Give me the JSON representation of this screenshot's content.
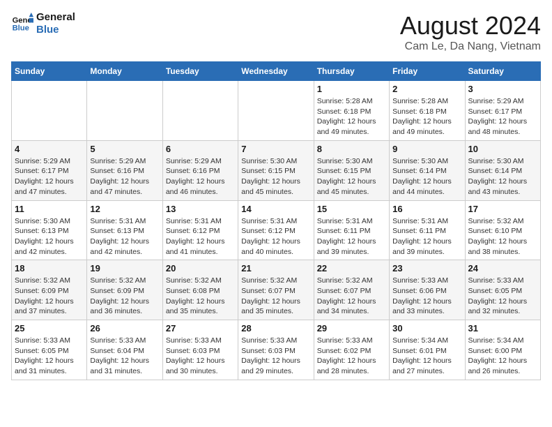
{
  "logo": {
    "name_line1": "General",
    "name_line2": "Blue"
  },
  "header": {
    "title": "August 2024",
    "subtitle": "Cam Le, Da Nang, Vietnam"
  },
  "weekdays": [
    "Sunday",
    "Monday",
    "Tuesday",
    "Wednesday",
    "Thursday",
    "Friday",
    "Saturday"
  ],
  "weeks": [
    [
      {
        "day": "",
        "info": ""
      },
      {
        "day": "",
        "info": ""
      },
      {
        "day": "",
        "info": ""
      },
      {
        "day": "",
        "info": ""
      },
      {
        "day": "1",
        "info": "Sunrise: 5:28 AM\nSunset: 6:18 PM\nDaylight: 12 hours\nand 49 minutes."
      },
      {
        "day": "2",
        "info": "Sunrise: 5:28 AM\nSunset: 6:18 PM\nDaylight: 12 hours\nand 49 minutes."
      },
      {
        "day": "3",
        "info": "Sunrise: 5:29 AM\nSunset: 6:17 PM\nDaylight: 12 hours\nand 48 minutes."
      }
    ],
    [
      {
        "day": "4",
        "info": "Sunrise: 5:29 AM\nSunset: 6:17 PM\nDaylight: 12 hours\nand 47 minutes."
      },
      {
        "day": "5",
        "info": "Sunrise: 5:29 AM\nSunset: 6:16 PM\nDaylight: 12 hours\nand 47 minutes."
      },
      {
        "day": "6",
        "info": "Sunrise: 5:29 AM\nSunset: 6:16 PM\nDaylight: 12 hours\nand 46 minutes."
      },
      {
        "day": "7",
        "info": "Sunrise: 5:30 AM\nSunset: 6:15 PM\nDaylight: 12 hours\nand 45 minutes."
      },
      {
        "day": "8",
        "info": "Sunrise: 5:30 AM\nSunset: 6:15 PM\nDaylight: 12 hours\nand 45 minutes."
      },
      {
        "day": "9",
        "info": "Sunrise: 5:30 AM\nSunset: 6:14 PM\nDaylight: 12 hours\nand 44 minutes."
      },
      {
        "day": "10",
        "info": "Sunrise: 5:30 AM\nSunset: 6:14 PM\nDaylight: 12 hours\nand 43 minutes."
      }
    ],
    [
      {
        "day": "11",
        "info": "Sunrise: 5:30 AM\nSunset: 6:13 PM\nDaylight: 12 hours\nand 42 minutes."
      },
      {
        "day": "12",
        "info": "Sunrise: 5:31 AM\nSunset: 6:13 PM\nDaylight: 12 hours\nand 42 minutes."
      },
      {
        "day": "13",
        "info": "Sunrise: 5:31 AM\nSunset: 6:12 PM\nDaylight: 12 hours\nand 41 minutes."
      },
      {
        "day": "14",
        "info": "Sunrise: 5:31 AM\nSunset: 6:12 PM\nDaylight: 12 hours\nand 40 minutes."
      },
      {
        "day": "15",
        "info": "Sunrise: 5:31 AM\nSunset: 6:11 PM\nDaylight: 12 hours\nand 39 minutes."
      },
      {
        "day": "16",
        "info": "Sunrise: 5:31 AM\nSunset: 6:11 PM\nDaylight: 12 hours\nand 39 minutes."
      },
      {
        "day": "17",
        "info": "Sunrise: 5:32 AM\nSunset: 6:10 PM\nDaylight: 12 hours\nand 38 minutes."
      }
    ],
    [
      {
        "day": "18",
        "info": "Sunrise: 5:32 AM\nSunset: 6:09 PM\nDaylight: 12 hours\nand 37 minutes."
      },
      {
        "day": "19",
        "info": "Sunrise: 5:32 AM\nSunset: 6:09 PM\nDaylight: 12 hours\nand 36 minutes."
      },
      {
        "day": "20",
        "info": "Sunrise: 5:32 AM\nSunset: 6:08 PM\nDaylight: 12 hours\nand 35 minutes."
      },
      {
        "day": "21",
        "info": "Sunrise: 5:32 AM\nSunset: 6:07 PM\nDaylight: 12 hours\nand 35 minutes."
      },
      {
        "day": "22",
        "info": "Sunrise: 5:32 AM\nSunset: 6:07 PM\nDaylight: 12 hours\nand 34 minutes."
      },
      {
        "day": "23",
        "info": "Sunrise: 5:33 AM\nSunset: 6:06 PM\nDaylight: 12 hours\nand 33 minutes."
      },
      {
        "day": "24",
        "info": "Sunrise: 5:33 AM\nSunset: 6:05 PM\nDaylight: 12 hours\nand 32 minutes."
      }
    ],
    [
      {
        "day": "25",
        "info": "Sunrise: 5:33 AM\nSunset: 6:05 PM\nDaylight: 12 hours\nand 31 minutes."
      },
      {
        "day": "26",
        "info": "Sunrise: 5:33 AM\nSunset: 6:04 PM\nDaylight: 12 hours\nand 31 minutes."
      },
      {
        "day": "27",
        "info": "Sunrise: 5:33 AM\nSunset: 6:03 PM\nDaylight: 12 hours\nand 30 minutes."
      },
      {
        "day": "28",
        "info": "Sunrise: 5:33 AM\nSunset: 6:03 PM\nDaylight: 12 hours\nand 29 minutes."
      },
      {
        "day": "29",
        "info": "Sunrise: 5:33 AM\nSunset: 6:02 PM\nDaylight: 12 hours\nand 28 minutes."
      },
      {
        "day": "30",
        "info": "Sunrise: 5:34 AM\nSunset: 6:01 PM\nDaylight: 12 hours\nand 27 minutes."
      },
      {
        "day": "31",
        "info": "Sunrise: 5:34 AM\nSunset: 6:00 PM\nDaylight: 12 hours\nand 26 minutes."
      }
    ]
  ]
}
